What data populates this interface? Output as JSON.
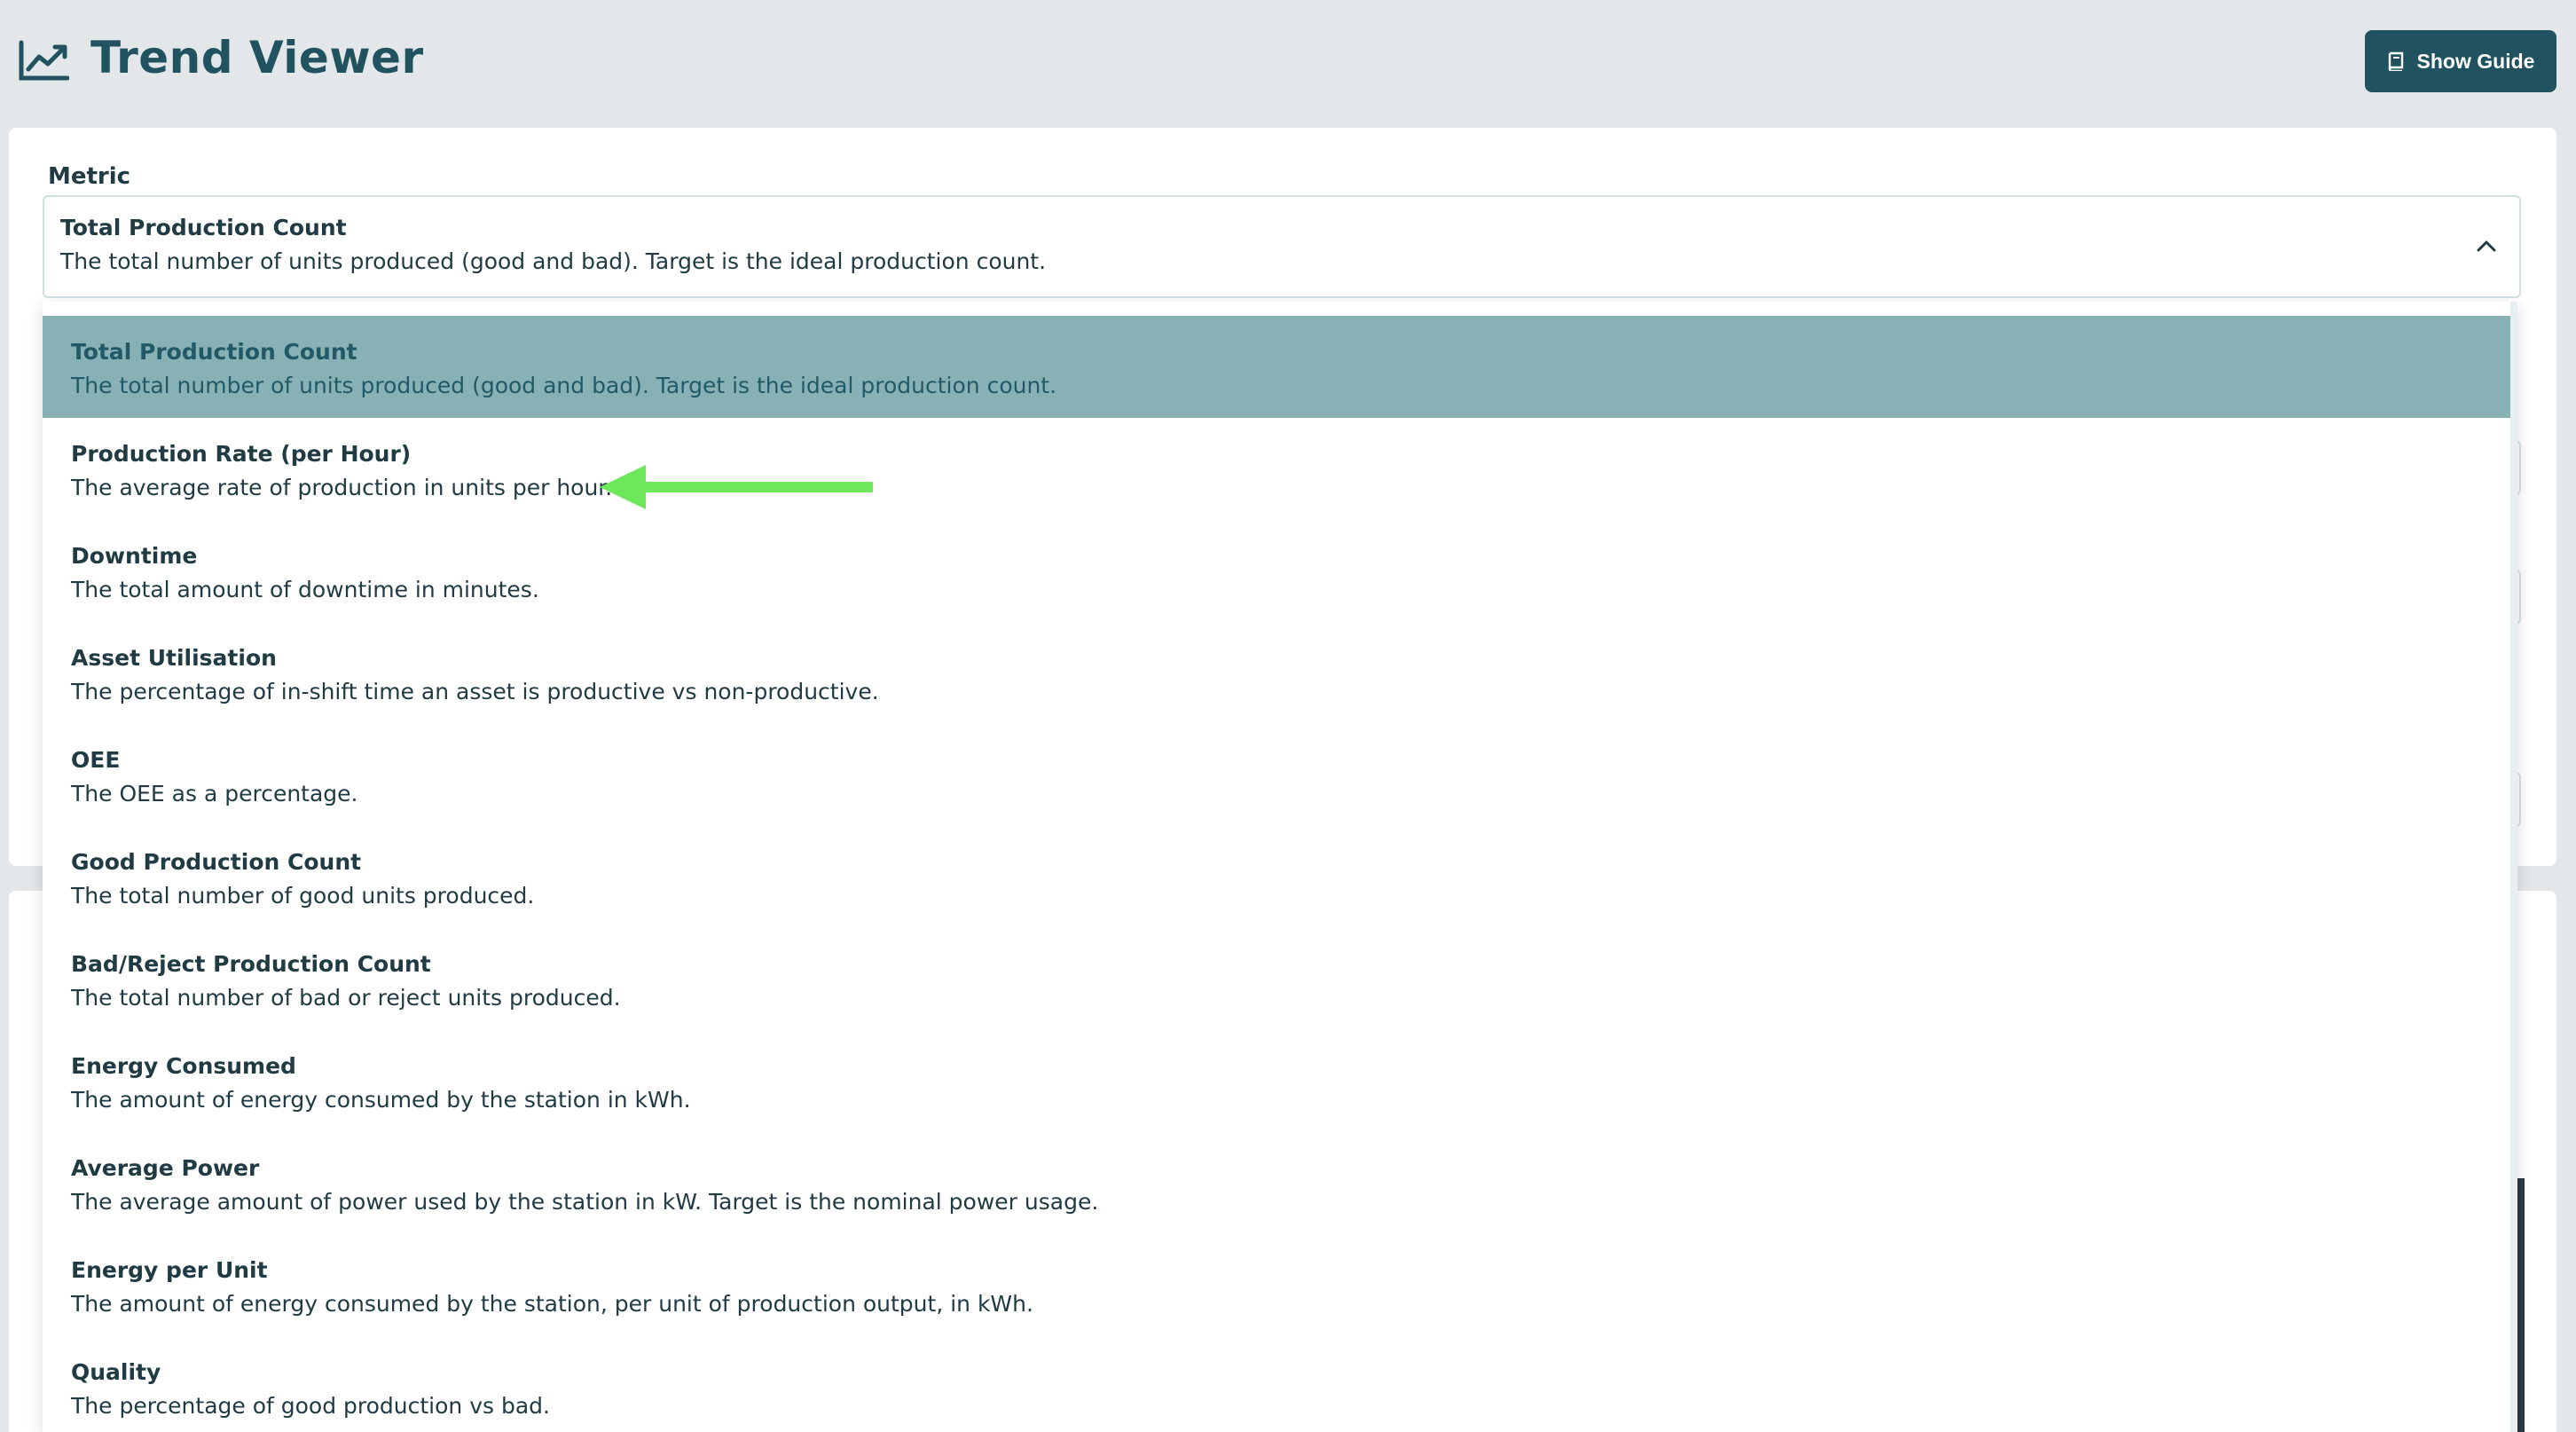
{
  "header": {
    "title": "Trend Viewer",
    "guide_button": "Show Guide"
  },
  "metric": {
    "label": "Metric",
    "selected_title": "Total Production Count",
    "selected_description": "The total number of units produced (good and bad). Target is the ideal production count."
  },
  "dropdown": {
    "options": [
      {
        "title": "Total Production Count",
        "description": "The total number of units produced (good and bad). Target is the ideal production count."
      },
      {
        "title": "Production Rate (per Hour)",
        "description": "The average rate of production in units per hour."
      },
      {
        "title": "Downtime",
        "description": "The total amount of downtime in minutes."
      },
      {
        "title": "Asset Utilisation",
        "description": "The percentage of in-shift time an asset is productive vs non-productive."
      },
      {
        "title": "OEE",
        "description": "The OEE as a percentage."
      },
      {
        "title": "Good Production Count",
        "description": "The total number of good units produced."
      },
      {
        "title": "Bad/Reject Production Count",
        "description": "The total number of bad or reject units produced."
      },
      {
        "title": "Energy Consumed",
        "description": "The amount of energy consumed by the station in kWh."
      },
      {
        "title": "Average Power",
        "description": "The average amount of power used by the station in kW. Target is the nominal power usage."
      },
      {
        "title": "Energy per Unit",
        "description": "The amount of energy consumed by the station, per unit of production output, in kWh."
      },
      {
        "title": "Quality",
        "description": "The percentage of good production vs bad."
      }
    ]
  },
  "colors": {
    "brand": "#21525f",
    "selected_option": "#88b1b5",
    "annotation_arrow": "#6ee85a"
  },
  "icons": {
    "app": "line-chart-icon",
    "guide": "book-icon",
    "select": "chevron-up-icon"
  }
}
